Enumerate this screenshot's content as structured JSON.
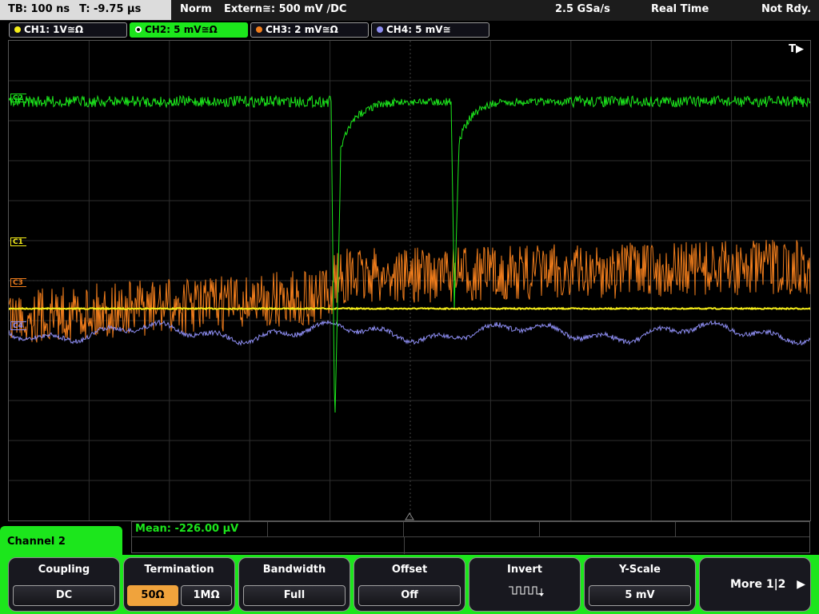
{
  "topbar": {
    "timebase": "TB: 100 ns",
    "trigger_time": "T: -9.75 µs",
    "mode": "Norm",
    "trigger_source": "Extern≅: 500 mV ∕DC",
    "sample_rate": "2.5 GSa/s",
    "acq_mode": "Real Time",
    "status": "Not Rdy."
  },
  "channels": [
    {
      "label": "CH1: 1V≅Ω",
      "color": "#f6ee1a",
      "active": false
    },
    {
      "label": "CH2: 5 mV≅Ω",
      "color": "#1ce61c",
      "active": true
    },
    {
      "label": "CH3: 2 mV≅Ω",
      "color": "#f07d1c",
      "active": false
    },
    {
      "label": "CH4: 5 mV≅",
      "color": "#8c8cf0",
      "active": false
    }
  ],
  "scope": {
    "trigger_marker": "T▶",
    "markers": [
      {
        "label": "C1",
        "color": "#f6ee1a"
      },
      {
        "label": "C3",
        "color": "#f07d1c"
      },
      {
        "label": "C4",
        "color": "#8c8cf0"
      },
      {
        "label": "C2",
        "color": "#1ce61c"
      }
    ]
  },
  "measurement": {
    "label": "Mean: -226.00 µV"
  },
  "menu": {
    "title": "Channel 2",
    "coupling": {
      "title": "Coupling",
      "value": "DC"
    },
    "termination": {
      "title": "Termination",
      "option_a": "50Ω",
      "option_b": "1MΩ"
    },
    "bandwidth": {
      "title": "Bandwidth",
      "value": "Full"
    },
    "offset": {
      "title": "Offset",
      "value": "Off"
    },
    "invert": {
      "title": "Invert"
    },
    "yscale": {
      "title": "Y-Scale",
      "value": "5 mV"
    },
    "more": {
      "label": "More 1|2",
      "arrow": "▶"
    }
  }
}
